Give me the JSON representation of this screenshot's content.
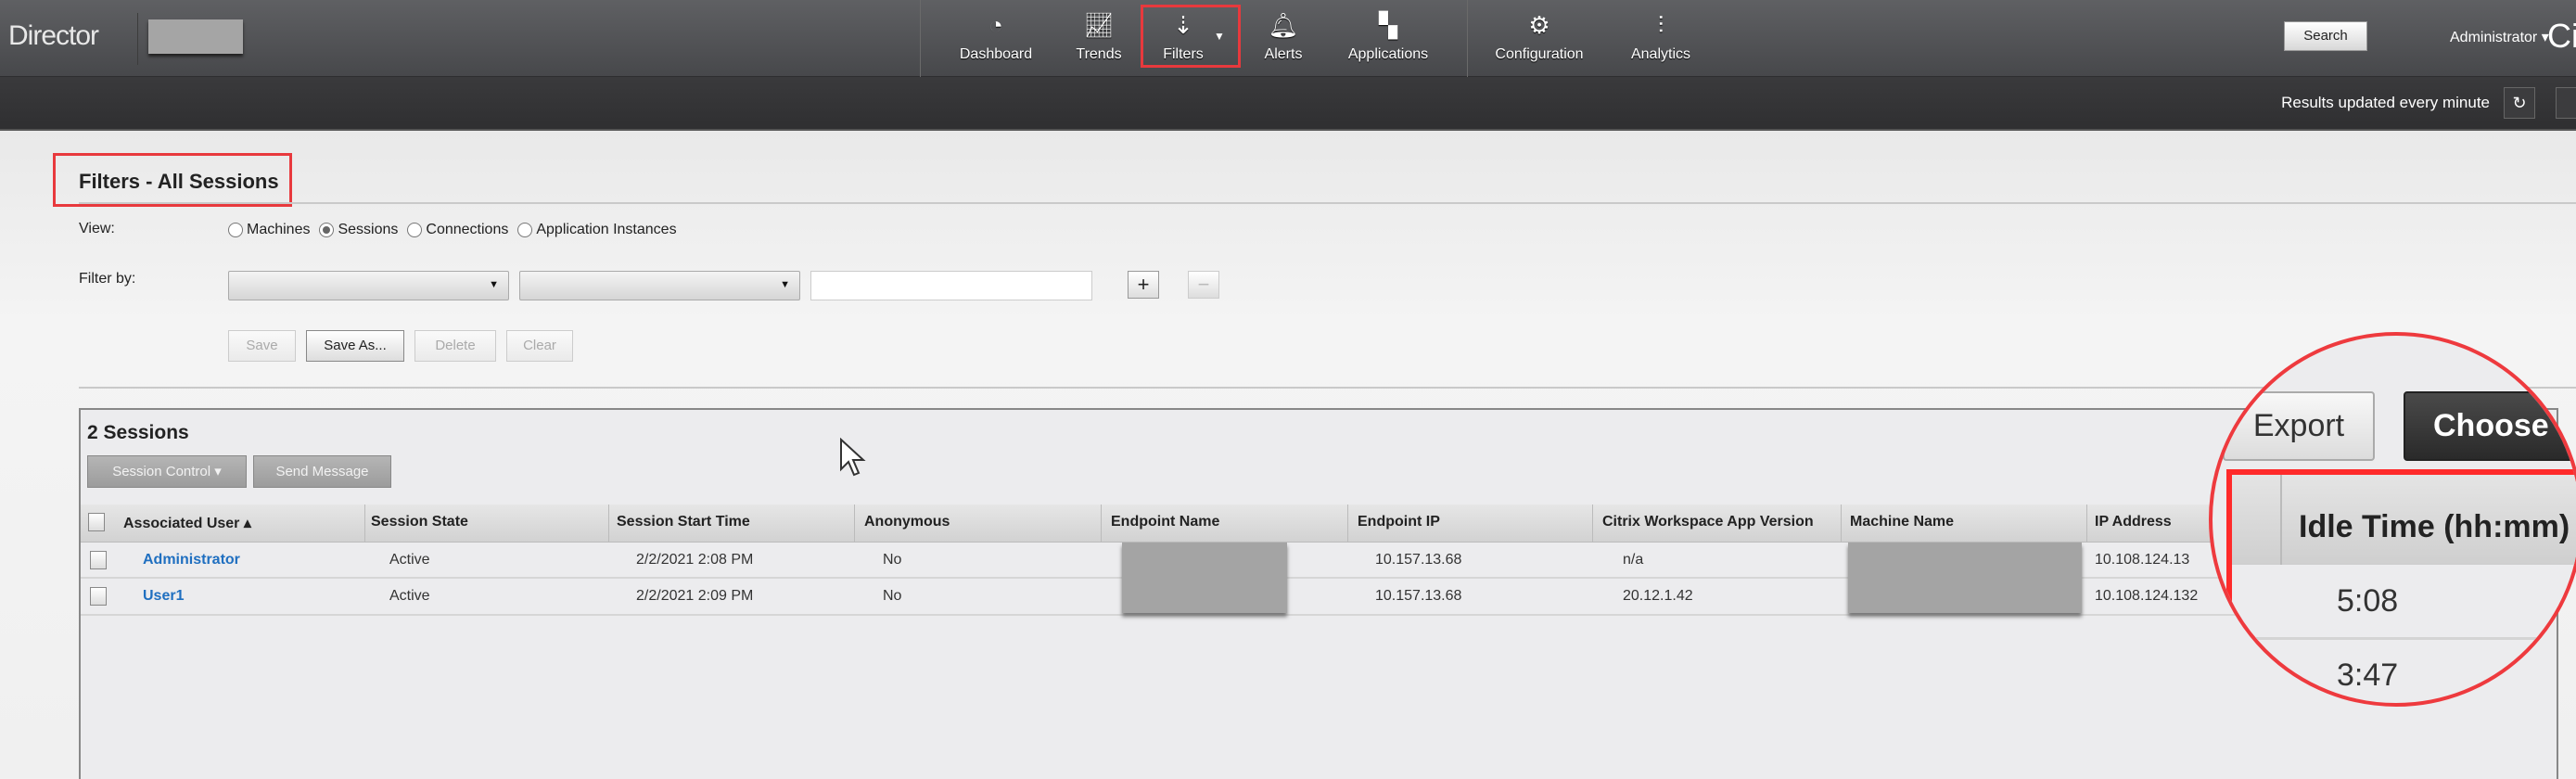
{
  "header": {
    "brand": "Director",
    "nav": [
      {
        "label": "Dashboard",
        "icon": "gauge-icon"
      },
      {
        "label": "Trends",
        "icon": "trends-icon"
      },
      {
        "label": "Filters",
        "icon": "filters-icon",
        "active": true
      },
      {
        "label": "Alerts",
        "icon": "bell-icon"
      },
      {
        "label": "Applications",
        "icon": "grid-icon"
      },
      {
        "label": "Configuration",
        "icon": "gear-icon"
      },
      {
        "label": "Analytics",
        "icon": "analytics-icon"
      }
    ],
    "search_label": "Search",
    "user": "Administrator",
    "logo_partial": "Ci"
  },
  "subbar": {
    "results_text": "Results updated every minute"
  },
  "filters": {
    "title": "Filters - All Sessions",
    "view_label": "View:",
    "view_options": [
      "Machines",
      "Sessions",
      "Connections",
      "Application Instances"
    ],
    "view_selected": "Sessions",
    "filter_by_label": "Filter by:",
    "add_label": "+",
    "remove_label": "−",
    "buttons": {
      "save": "Save",
      "save_as": "Save As...",
      "delete": "Delete",
      "clear": "Clear"
    }
  },
  "sessions": {
    "count_label": "2 Sessions",
    "session_control": "Session Control ▾",
    "send_message": "Send Message",
    "export": "Export",
    "choose": "Choose",
    "columns": [
      "Associated User ▴",
      "Session State",
      "Session Start Time",
      "Anonymous",
      "Endpoint Name",
      "Endpoint IP",
      "Citrix Workspace App Version",
      "Machine Name",
      "IP Address",
      "Idle Time (hh:mm)"
    ],
    "rows": [
      {
        "user": "Administrator",
        "state": "Active",
        "start": "2/2/2021 2:08 PM",
        "anonymous": "No",
        "endpoint_ip": "10.157.13.68",
        "app_version": "n/a",
        "ip": "10.108.124.13",
        "idle": "5:08"
      },
      {
        "user": "User1",
        "state": "Active",
        "start": "2/2/2021 2:09 PM",
        "anonymous": "No",
        "endpoint_ip": "10.157.13.68",
        "app_version": "20.12.1.42",
        "ip": "10.108.124.132",
        "idle": "3:47"
      }
    ]
  },
  "colors": {
    "highlight": "#e8393d",
    "link": "#1f6fc0",
    "nav_bg": "#4f5053"
  }
}
